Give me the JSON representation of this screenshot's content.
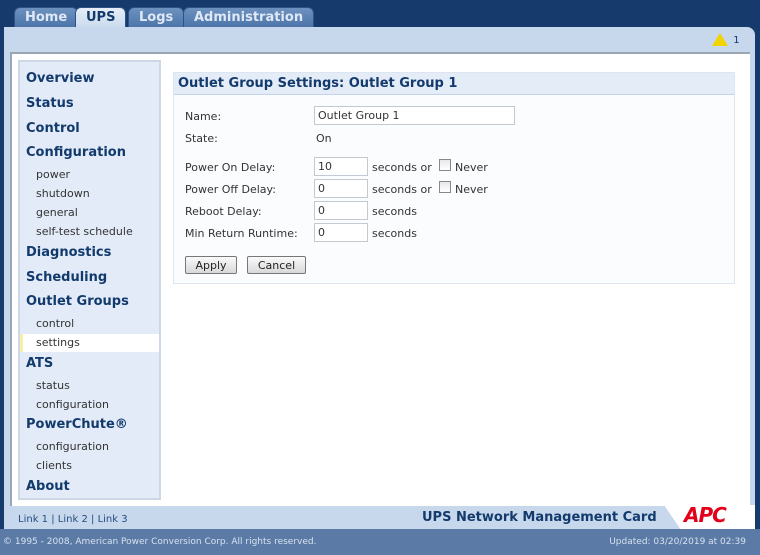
{
  "tabs": [
    "Home",
    "UPS",
    "Logs",
    "Administration"
  ],
  "alert_count": "1",
  "sidebar": {
    "overview": "Overview",
    "status": "Status",
    "control": "Control",
    "configuration": "Configuration",
    "config_items": [
      "power",
      "shutdown",
      "general",
      "self-test schedule"
    ],
    "diagnostics": "Diagnostics",
    "scheduling": "Scheduling",
    "outlet_groups": "Outlet Groups",
    "outlet_items": [
      "control",
      "settings"
    ],
    "ats": "ATS",
    "ats_items": [
      "status",
      "configuration"
    ],
    "powerchute": "PowerChute®",
    "powerchute_items": [
      "configuration",
      "clients"
    ],
    "about": "About"
  },
  "panel": {
    "title": "Outlet Group Settings: Outlet Group 1",
    "name_label": "Name:",
    "name_value": "Outlet Group 1",
    "state_label": "State:",
    "state_value": "On",
    "power_on_label": "Power On Delay:",
    "power_on_value": "10",
    "power_off_label": "Power Off Delay:",
    "power_off_value": "0",
    "reboot_label": "Reboot Delay:",
    "reboot_value": "0",
    "min_return_label": "Min Return Runtime:",
    "min_return_value": "0",
    "seconds_or": "seconds or",
    "seconds": "seconds",
    "never": "Never",
    "apply": "Apply",
    "cancel": "Cancel"
  },
  "footer": {
    "link1": "Link 1",
    "link2": "Link 2",
    "link3": "Link 3",
    "sep": "|",
    "product": "UPS Network Management Card",
    "logo": "APC",
    "copyright": "© 1995 - 2008, American Power Conversion Corp. All rights reserved.",
    "updated": "Updated: 03/20/2019 at 02:39"
  }
}
